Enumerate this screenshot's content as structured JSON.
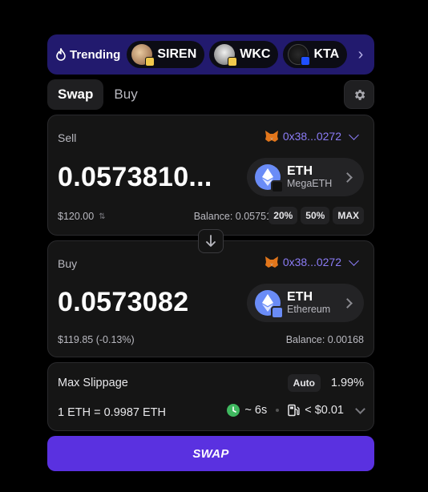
{
  "trending": {
    "label": "Trending",
    "items": [
      {
        "symbol": "SIREN"
      },
      {
        "symbol": "WKC"
      },
      {
        "symbol": "KTA"
      }
    ]
  },
  "tabs": [
    {
      "label": "Swap",
      "active": true
    },
    {
      "label": "Buy",
      "active": false
    }
  ],
  "sell": {
    "label": "Sell",
    "wallet": "0x38...0272",
    "amount": "0.0573810...",
    "token": {
      "symbol": "ETH",
      "chain": "MegaETH"
    },
    "usd_value": "$120.00",
    "balance": "Balance: 0.05751",
    "percent_options": [
      "20%",
      "50%",
      "MAX"
    ]
  },
  "buy": {
    "label": "Buy",
    "wallet": "0x38...0272",
    "amount": "0.0573082",
    "token": {
      "symbol": "ETH",
      "chain": "Ethereum"
    },
    "usd_value": "$119.85 (-0.13%)",
    "balance": "Balance: 0.00168"
  },
  "details": {
    "slippage_label": "Max Slippage",
    "slippage_mode": "Auto",
    "slippage_value": "1.99%",
    "rate": "1 ETH = 0.9987 ETH",
    "time": "~ 6s",
    "gas": "< $0.01"
  },
  "swap_button": "SWAP",
  "colors": {
    "accent": "#5a31e0",
    "trending_bg": "#221a6e",
    "wallet_text": "#8b7cf6",
    "eth_blue": "#6a8cf7",
    "time_green": "#3fb85f"
  }
}
